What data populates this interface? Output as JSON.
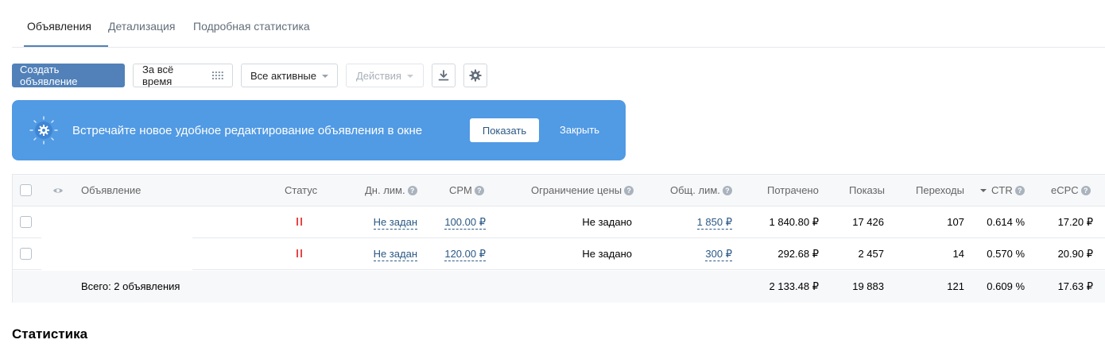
{
  "tabs": [
    {
      "label": "Объявления",
      "active": true
    },
    {
      "label": "Детализация",
      "active": false
    },
    {
      "label": "Подробная статистика",
      "active": false
    }
  ],
  "toolbar": {
    "create_label": "Создать объявление",
    "period_label": "За всё время",
    "filter_label": "Все активные",
    "actions_label": "Действия",
    "download_icon": "download-icon",
    "settings_icon": "gear-icon"
  },
  "banner": {
    "text": "Встречайте новое удобное редактирование объявления в окне",
    "show_label": "Показать",
    "close_label": "Закрыть",
    "color": "#519ae4"
  },
  "table": {
    "columns": {
      "ad": "Объявление",
      "status": "Статус",
      "daily_limit": "Дн. лим.",
      "cpm": "CPM",
      "price_limit": "Ограничение цены",
      "total_limit": "Общ. лим.",
      "spent": "Потрачено",
      "impressions": "Показы",
      "clicks": "Переходы",
      "ctr": "CTR",
      "ecpc": "eCPC"
    },
    "rows": [
      {
        "status": "paused",
        "daily_limit": "Не задан",
        "cpm": "100.00 ₽",
        "price_limit": "Не задано",
        "total_limit": "1 850 ₽",
        "spent": "1 840.80 ₽",
        "impressions": "17 426",
        "clicks": "107",
        "ctr": "0.614 %",
        "ecpc": "17.20 ₽"
      },
      {
        "status": "paused",
        "daily_limit": "Не задан",
        "cpm": "120.00 ₽",
        "price_limit": "Не задано",
        "total_limit": "300 ₽",
        "spent": "292.68 ₽",
        "impressions": "2 457",
        "clicks": "14",
        "ctr": "0.570 %",
        "ecpc": "20.90 ₽"
      }
    ],
    "total": {
      "label": "Всего: 2 объявления",
      "spent": "2 133.48 ₽",
      "impressions": "19 883",
      "clicks": "121",
      "ctr": "0.609 %",
      "ecpc": "17.63 ₽"
    }
  },
  "section_title": "Статистика",
  "colors": {
    "accent": "#5181b8",
    "paused": "#e64646",
    "link": "#2a5885"
  }
}
